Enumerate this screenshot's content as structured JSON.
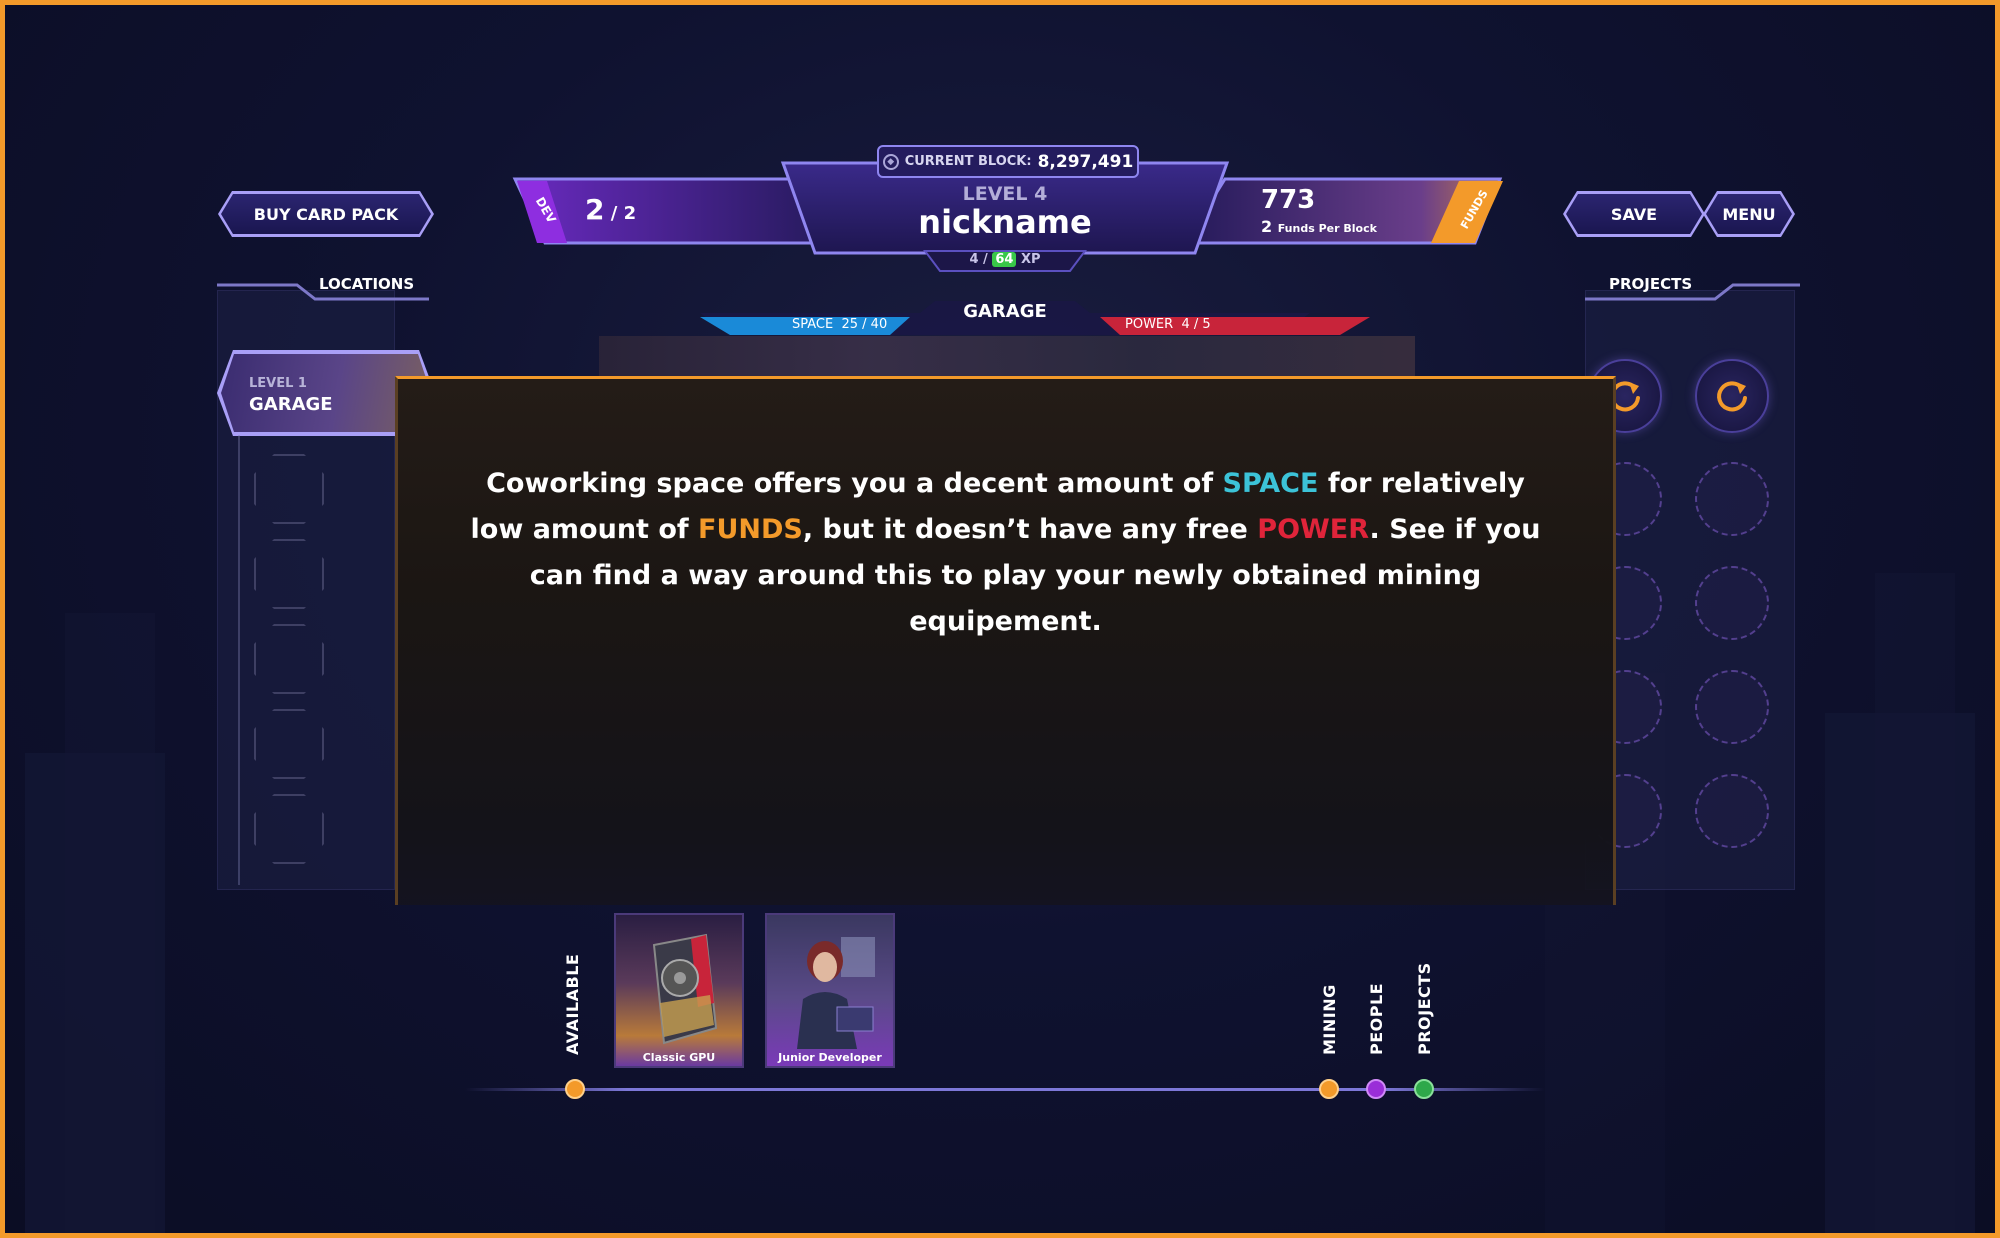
{
  "header": {
    "current_block_label": "CURRENT BLOCK:",
    "current_block_value": "8,297,491",
    "level": "LEVEL 4",
    "nickname": "nickname",
    "xp_current": "4",
    "xp_sep": " / ",
    "xp_total": "64",
    "xp_unit": " XP",
    "dev_tag": "DEV",
    "dev_count": "2",
    "dev_sep": " / ",
    "dev_max": "2",
    "funds_tag": "FUNDS",
    "funds_value": "773",
    "funds_per_block_value": "2",
    "funds_per_block_label": "Funds Per Block"
  },
  "buttons": {
    "buy_card_pack": "BUY CARD PACK",
    "save": "SAVE",
    "menu": "MENU"
  },
  "sidebar_left": {
    "title": "LOCATIONS",
    "active_location": {
      "level": "LEVEL 1",
      "name": "GARAGE"
    }
  },
  "sidebar_right": {
    "title": "PROJECTS"
  },
  "location_bar": {
    "name": "GARAGE",
    "space_label": "SPACE",
    "space_value": "25 / 40",
    "power_label": "POWER",
    "power_value": "4 / 5"
  },
  "modal": {
    "t1": "Coworking space offers you a decent amount of ",
    "space": "SPACE",
    "t2": " for relatively low amount of ",
    "funds": "FUNDS",
    "t3": ", but it doesn’t have any free ",
    "power": "POWER",
    "t4": ". See if you can find a way around this to play your newly obtained mining equipement."
  },
  "hand": {
    "available_label": "AVAILABLE",
    "cards": [
      {
        "name": "Classic GPU"
      },
      {
        "name": "Junior Developer"
      }
    ],
    "filters": [
      "MINING",
      "PEOPLE",
      "PROJECTS"
    ]
  },
  "colors": {
    "accent_orange": "#f39a2a",
    "space_blue": "#3cc3d8",
    "power_red": "#e0243a",
    "dev_purple": "#8e2ee0",
    "people_purple": "#9a2ed8",
    "projects_green": "#2ea84a",
    "xp_green": "#38c848"
  }
}
